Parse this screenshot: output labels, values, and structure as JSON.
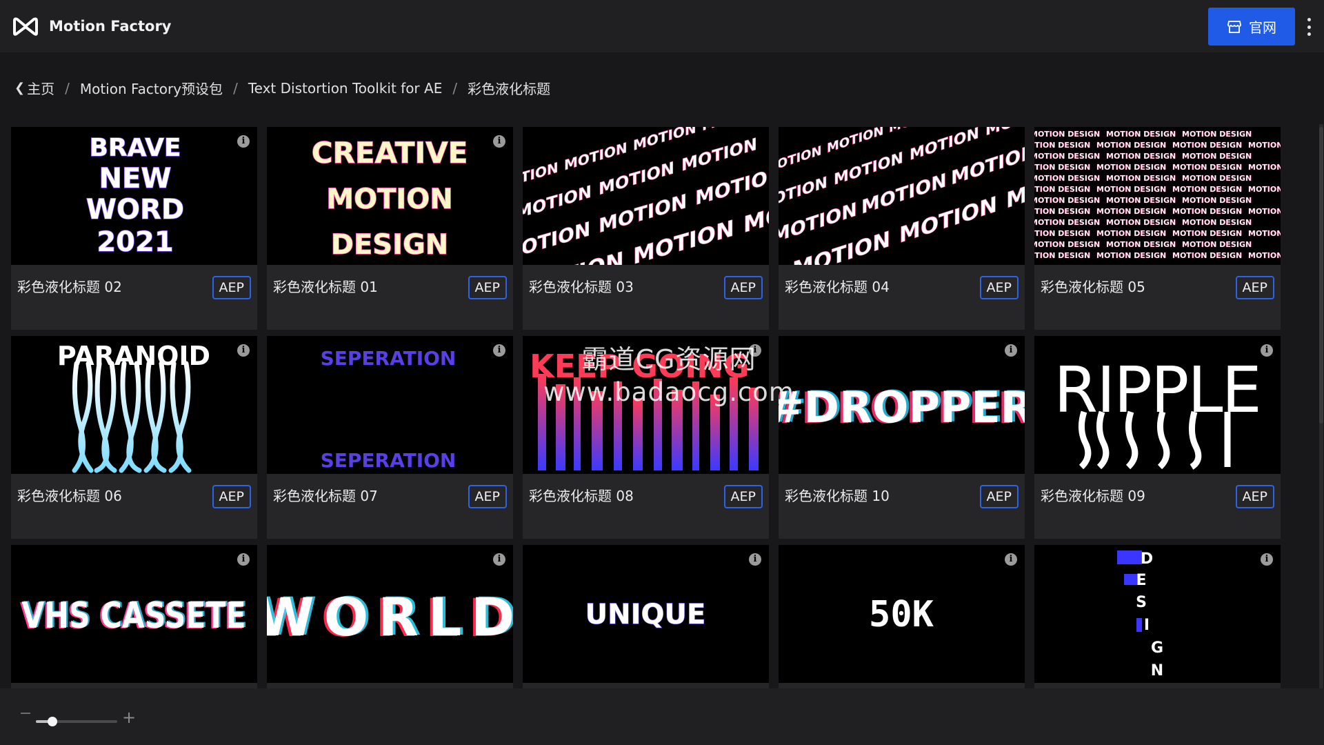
{
  "app": {
    "title": "Motion Factory",
    "official_label": "官网"
  },
  "breadcrumb": {
    "items": [
      "主页",
      "Motion Factory预设包",
      "Text Distortion Toolkit for AE",
      "彩色液化标题"
    ]
  },
  "cards": [
    {
      "title": "彩色液化标题 02",
      "badge": "AEP",
      "preview": [
        "BRAVE",
        "NEW",
        "WORD",
        "2021"
      ]
    },
    {
      "title": "彩色液化标题 01",
      "badge": "AEP",
      "preview": [
        "CREATIVE",
        "MOTION",
        "DESIGN"
      ]
    },
    {
      "title": "彩色液化标题 03",
      "badge": "AEP",
      "preview": [
        "MOTION"
      ]
    },
    {
      "title": "彩色液化标题 04",
      "badge": "AEP",
      "preview": [
        "MOTION"
      ]
    },
    {
      "title": "彩色液化标题 05",
      "badge": "AEP",
      "preview": [
        "MOTION DESIGN"
      ]
    },
    {
      "title": "彩色液化标题 06",
      "badge": "AEP",
      "preview": [
        "PARANOID"
      ]
    },
    {
      "title": "彩色液化标题 07",
      "badge": "AEP",
      "preview": [
        "SEPERATION"
      ]
    },
    {
      "title": "彩色液化标题 08",
      "badge": "AEP",
      "preview": [
        "KEEP GOING"
      ]
    },
    {
      "title": "彩色液化标题 10",
      "badge": "AEP",
      "preview": [
        "#DROPPER"
      ]
    },
    {
      "title": "彩色液化标题 09",
      "badge": "AEP",
      "preview": [
        "RIPPLE"
      ]
    },
    {
      "title": "",
      "badge": "",
      "preview": [
        "VHS CASSETE"
      ]
    },
    {
      "title": "",
      "badge": "",
      "preview": [
        "WORLD"
      ]
    },
    {
      "title": "",
      "badge": "",
      "preview": [
        "UNIQUE"
      ]
    },
    {
      "title": "",
      "badge": "",
      "preview": [
        "50K"
      ]
    },
    {
      "title": "",
      "badge": "",
      "preview": [
        "D",
        "E",
        "S",
        "I",
        "G",
        "N"
      ]
    }
  ],
  "watermark": {
    "line1": "霸道CG资源网",
    "line2": "www.badaocg.com"
  },
  "zoom": {
    "minus": "−",
    "plus": "+",
    "level": 0.2
  },
  "colors": {
    "accent": "#1f5be7",
    "badge_border": "#2c63e8",
    "background": "#18181a",
    "card": "#262628"
  },
  "icons": {
    "logo": "motion-factory-logo",
    "official": "store-icon",
    "more": "kebab-menu-icon",
    "info": "info-icon",
    "back": "chevron-left-icon"
  }
}
